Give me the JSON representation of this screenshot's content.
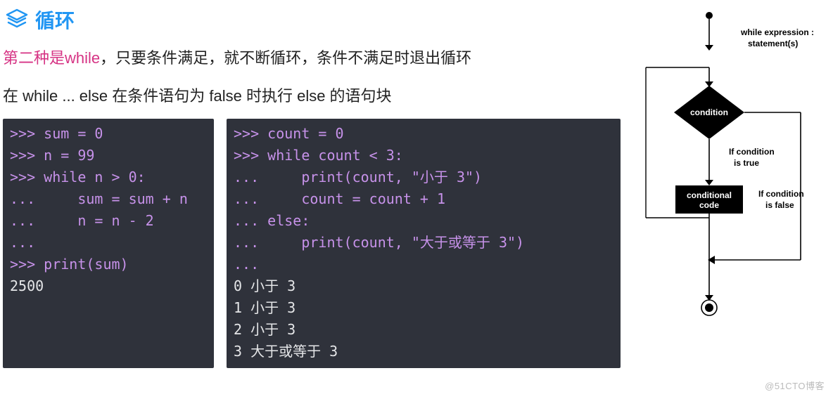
{
  "header": {
    "title": "循环"
  },
  "paragraph1": {
    "pre": "第二种是",
    "keyword": "while",
    "post": "，只要条件满足，就不断循环，条件不满足时退出循环"
  },
  "paragraph2": "在 while ... else 在条件语句为 false 时执行 else 的语句块",
  "code_left": {
    "l1": ">>> sum = 0",
    "l2": ">>> n = 99",
    "l3": ">>> while n > 0:",
    "l4": "...     sum = sum + n",
    "l5": "...     n = n - 2",
    "l6": "...",
    "l7": ">>> print(sum)",
    "l8": "2500"
  },
  "code_right": {
    "l1": ">>> count = 0",
    "l2": ">>> while count < 3:",
    "l3": "...     print(count, \"小于 3\")",
    "l4": "...     count = count + 1",
    "l5": "... else:",
    "l6": "...     print(count, \"大于或等于 3\")",
    "l7": "...",
    "l8": "0 小于 3",
    "l9": "1 小于 3",
    "l10": "2 小于 3",
    "l11": "3 大于或等于 3"
  },
  "diagram": {
    "header1": "while expression :",
    "header2": "statement(s)",
    "condition": "condition",
    "true_label1": "If condition",
    "true_label2": "is true",
    "false_label1": "If condition",
    "false_label2": "is false",
    "codebox1": "conditional",
    "codebox2": "code"
  },
  "watermark": "@51CTO博客"
}
